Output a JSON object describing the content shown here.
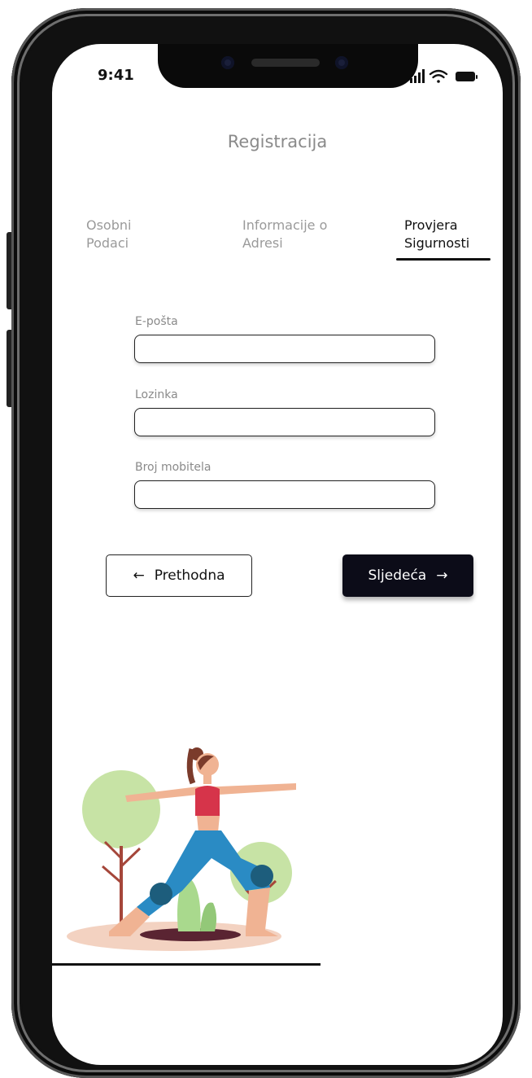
{
  "status_bar": {
    "time": "9:41",
    "icons": [
      "signal-icon",
      "wifi-icon",
      "battery-icon"
    ]
  },
  "header": {
    "title": "Registracija"
  },
  "steps": [
    {
      "line1": "Osobni",
      "line2": "Podaci",
      "active": false
    },
    {
      "line1": "Informacije o",
      "line2": "Adresi",
      "active": false
    },
    {
      "line1": "Provjera",
      "line2": "Sigurnosti",
      "active": true
    }
  ],
  "form": {
    "email_label": "E-pošta",
    "email_value": "",
    "password_label": "Lozinka",
    "password_value": "",
    "phone_label": "Broj mobitela",
    "phone_value": ""
  },
  "buttons": {
    "prev_label": "Prethodna",
    "prev_icon": "arrow-left-icon",
    "next_label": "Sljedeća",
    "next_icon": "arrow-right-icon"
  },
  "colors": {
    "primary_button": "#0c0c18",
    "muted_text": "#8a8a8a",
    "active_text": "#111111"
  },
  "illustration": {
    "icon": "woman-yoga-warrior-pose-illustration"
  }
}
